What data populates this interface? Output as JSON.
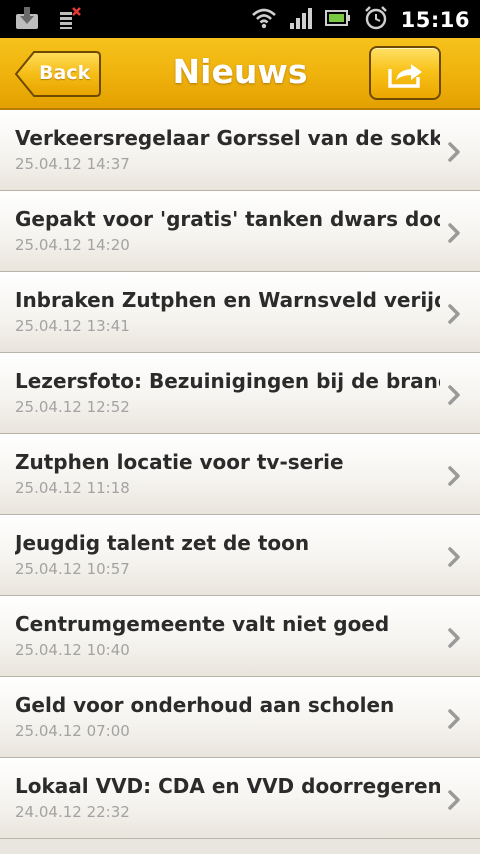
{
  "status_bar": {
    "time": "15:16",
    "icons": [
      "download-icon",
      "sim-alert-icon",
      "wifi-icon",
      "signal-icon",
      "battery-icon",
      "alarm-clock-icon"
    ]
  },
  "header": {
    "title": "Nieuws",
    "back_label": "Back",
    "share_icon": "share-icon",
    "accent_color": "#f2b611"
  },
  "news": [
    {
      "title": "Verkeersregelaar Gorssel van de sokke...",
      "date": "25.04.12 14:37"
    },
    {
      "title": "Gepakt voor 'gratis' tanken dwars door...",
      "date": "25.04.12 14:20"
    },
    {
      "title": "Inbraken Zutphen en Warnsveld verijd...",
      "date": "25.04.12 13:41"
    },
    {
      "title": "Lezersfoto: Bezuinigingen bij de brand...",
      "date": "25.04.12 12:52"
    },
    {
      "title": "Zutphen locatie voor tv-serie",
      "date": "25.04.12 11:18"
    },
    {
      "title": "Jeugdig talent zet de toon",
      "date": "25.04.12 10:57"
    },
    {
      "title": "Centrumgemeente valt niet goed",
      "date": "25.04.12 10:40"
    },
    {
      "title": "Geld voor onderhoud aan scholen",
      "date": "25.04.12 07:00"
    },
    {
      "title": "Lokaal VVD: CDA en VVD doorregeren",
      "date": "24.04.12 22:32"
    }
  ]
}
